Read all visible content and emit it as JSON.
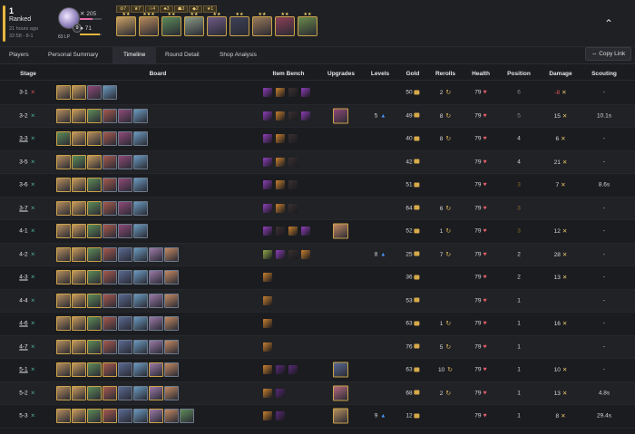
{
  "header": {
    "placement": "1",
    "mode": "Ranked",
    "time_ago": "21 hours ago",
    "duration_stage": "32:58 - 8-1",
    "level": "9",
    "lp": "83 LP",
    "stat_top": "205",
    "stat_bottom": "71",
    "stat_top_fill": 0.6,
    "stat_bottom_fill": 0.9,
    "traits": [
      "⚙7",
      "♛7",
      "☉4",
      "♣3",
      "☗3",
      "◆2",
      "★1"
    ],
    "champions": [
      {
        "color": "#c9a063",
        "stars": "★★"
      },
      {
        "color": "#b78a5a",
        "stars": "★★★"
      },
      {
        "color": "#5b8a5a",
        "stars": "★★"
      },
      {
        "color": "#8a9a86",
        "stars": "★★"
      },
      {
        "color": "#6f5a86",
        "stars": "★★"
      },
      {
        "color": "#3e4158",
        "stars": "★★"
      },
      {
        "color": "#9a7a58",
        "stars": "★★"
      },
      {
        "color": "#8c3f57",
        "stars": "★★"
      },
      {
        "color": "#6a8a4a",
        "stars": "★★"
      }
    ]
  },
  "tabs": [
    {
      "label": "Players",
      "active": false
    },
    {
      "label": "Personal Summary",
      "active": false
    },
    {
      "label": "Timeline",
      "active": true
    },
    {
      "label": "Round Detail",
      "active": false
    },
    {
      "label": "Shop Analysis",
      "active": false
    }
  ],
  "copy_link": "⇔ Copy Link",
  "columns": [
    "Stage",
    "Board",
    "Item Bench",
    "Upgrades",
    "Levels",
    "Gold",
    "Rerolls",
    "Health",
    "Position",
    "Damage",
    "Scouting"
  ],
  "unit_palette": [
    "#b58e5e",
    "#c79b5d",
    "#5f8c58",
    "#a65a4f",
    "#8f4a78",
    "#6a9abf",
    "#9c7aa8",
    "#c48a62",
    "#5a6a92",
    "#8a5a4a",
    "#b56a7e",
    "#7a8c5a"
  ],
  "item_palette": [
    "#8e3fb8",
    "#c9812f",
    "#3b3030",
    "#8fa84a",
    "#5a2a78",
    "#b0403a"
  ],
  "rows": [
    {
      "stage": "3-1",
      "result": "loss",
      "underline": false,
      "board": [
        0,
        1,
        4,
        5
      ],
      "stars": [
        2,
        2,
        1,
        1
      ],
      "items": [
        0,
        1,
        2,
        0
      ],
      "upgrades": [],
      "levels": "",
      "gold": "50",
      "rerolls": "2",
      "health": "79",
      "position": "6",
      "posc": "gray",
      "damage": "-8",
      "dmgc": "neg",
      "scouting": "-"
    },
    {
      "stage": "3-2",
      "result": "win",
      "underline": false,
      "board": [
        0,
        1,
        2,
        3,
        4,
        5
      ],
      "stars": [
        2,
        2,
        2,
        1,
        1,
        1
      ],
      "items": [
        0,
        1,
        2,
        0
      ],
      "upgrades": [
        4
      ],
      "levels": "5",
      "gold": "49",
      "rerolls": "8",
      "health": "79",
      "position": "5",
      "posc": "gray",
      "damage": "15",
      "dmgc": "pos",
      "scouting": "10.1s"
    },
    {
      "stage": "3-3",
      "result": "win",
      "underline": true,
      "board": [
        2,
        1,
        0,
        3,
        4,
        5
      ],
      "stars": [
        2,
        2,
        2,
        1,
        1,
        1
      ],
      "items": [
        0,
        1,
        2
      ],
      "upgrades": [],
      "levels": "",
      "gold": "40",
      "rerolls": "8",
      "health": "79",
      "position": "4",
      "posc": "norm",
      "damage": "6",
      "dmgc": "pos",
      "scouting": "-"
    },
    {
      "stage": "3-5",
      "result": "win",
      "underline": false,
      "board": [
        0,
        2,
        1,
        3,
        4,
        5
      ],
      "stars": [
        2,
        2,
        2,
        1,
        1,
        1
      ],
      "items": [
        0,
        1,
        2
      ],
      "upgrades": [],
      "levels": "",
      "gold": "42",
      "rerolls": "",
      "health": "79",
      "position": "4",
      "posc": "norm",
      "damage": "21",
      "dmgc": "pos",
      "scouting": "-"
    },
    {
      "stage": "3-6",
      "result": "win",
      "underline": false,
      "board": [
        0,
        1,
        2,
        3,
        4,
        5
      ],
      "stars": [
        2,
        2,
        2,
        1,
        1,
        1
      ],
      "items": [
        0,
        1,
        2
      ],
      "upgrades": [],
      "levels": "",
      "gold": "51",
      "rerolls": "",
      "health": "79",
      "position": "3",
      "posc": "muted",
      "damage": "7",
      "dmgc": "pos",
      "scouting": "8.6s"
    },
    {
      "stage": "3-7",
      "result": "win",
      "underline": true,
      "board": [
        0,
        1,
        2,
        3,
        4,
        5
      ],
      "stars": [
        2,
        2,
        2,
        1,
        1,
        1
      ],
      "items": [
        0,
        1,
        2
      ],
      "upgrades": [],
      "levels": "",
      "gold": "64",
      "rerolls": "6",
      "health": "79",
      "position": "3",
      "posc": "muted",
      "damage": "",
      "dmgc": "pos",
      "scouting": "-"
    },
    {
      "stage": "4-1",
      "result": "win",
      "underline": false,
      "board": [
        0,
        1,
        2,
        3,
        4,
        5
      ],
      "stars": [
        2,
        2,
        2,
        1,
        1,
        1
      ],
      "items": [
        0,
        2,
        1,
        0
      ],
      "upgrades": [
        7
      ],
      "levels": "",
      "gold": "52",
      "rerolls": "1",
      "health": "79",
      "position": "3",
      "posc": "muted",
      "damage": "12",
      "dmgc": "pos",
      "scouting": "-"
    },
    {
      "stage": "4-2",
      "result": "win",
      "underline": false,
      "board": [
        0,
        1,
        2,
        3,
        8,
        5,
        6,
        7
      ],
      "stars": [
        2,
        2,
        2,
        1,
        1,
        1,
        1,
        1
      ],
      "items": [
        3,
        0,
        2,
        1
      ],
      "upgrades": [],
      "levels": "8",
      "gold": "25",
      "rerolls": "7",
      "health": "79",
      "position": "2",
      "posc": "norm",
      "damage": "28",
      "dmgc": "pos",
      "scouting": "-"
    },
    {
      "stage": "4-3",
      "result": "win",
      "underline": true,
      "board": [
        0,
        1,
        2,
        3,
        8,
        5,
        6,
        7
      ],
      "stars": [
        2,
        2,
        2,
        1,
        1,
        1,
        1,
        1
      ],
      "items": [
        1
      ],
      "upgrades": [],
      "levels": "",
      "gold": "36",
      "rerolls": "",
      "health": "79",
      "position": "2",
      "posc": "norm",
      "damage": "13",
      "dmgc": "pos",
      "scouting": "-"
    },
    {
      "stage": "4-4",
      "result": "win",
      "underline": false,
      "board": [
        0,
        1,
        2,
        3,
        8,
        5,
        6,
        7
      ],
      "stars": [
        2,
        2,
        2,
        1,
        1,
        1,
        1,
        1
      ],
      "items": [
        1
      ],
      "upgrades": [],
      "levels": "",
      "gold": "53",
      "rerolls": "",
      "health": "79",
      "position": "1",
      "posc": "norm",
      "damage": "",
      "dmgc": "pos",
      "scouting": "-"
    },
    {
      "stage": "4-6",
      "result": "win",
      "underline": true,
      "board": [
        0,
        1,
        2,
        3,
        8,
        5,
        6,
        7
      ],
      "stars": [
        2,
        2,
        2,
        1,
        1,
        1,
        1,
        1
      ],
      "items": [
        1
      ],
      "upgrades": [],
      "levels": "",
      "gold": "63",
      "rerolls": "1",
      "health": "79",
      "position": "1",
      "posc": "norm",
      "damage": "16",
      "dmgc": "pos",
      "scouting": "-"
    },
    {
      "stage": "4-7",
      "result": "win",
      "underline": true,
      "board": [
        0,
        1,
        2,
        3,
        8,
        5,
        6,
        7
      ],
      "stars": [
        2,
        2,
        2,
        1,
        1,
        1,
        1,
        1
      ],
      "items": [
        1
      ],
      "upgrades": [],
      "levels": "",
      "gold": "76",
      "rerolls": "5",
      "health": "79",
      "position": "1",
      "posc": "norm",
      "damage": "",
      "dmgc": "pos",
      "scouting": "-"
    },
    {
      "stage": "5-1",
      "result": "win",
      "underline": true,
      "board": [
        0,
        1,
        2,
        3,
        8,
        5,
        6,
        7
      ],
      "stars": [
        2,
        2,
        2,
        2,
        1,
        1,
        2,
        1
      ],
      "items": [
        1,
        4,
        4
      ],
      "upgrades": [
        8
      ],
      "levels": "",
      "gold": "63",
      "rerolls": "10",
      "health": "79",
      "position": "1",
      "posc": "norm",
      "damage": "10",
      "dmgc": "pos",
      "scouting": "-"
    },
    {
      "stage": "5-2",
      "result": "win",
      "underline": false,
      "board": [
        0,
        1,
        2,
        3,
        8,
        5,
        6,
        7
      ],
      "stars": [
        2,
        2,
        2,
        2,
        1,
        1,
        2,
        1
      ],
      "items": [
        1,
        4
      ],
      "upgrades": [
        10
      ],
      "levels": "",
      "gold": "68",
      "rerolls": "2",
      "health": "79",
      "position": "1",
      "posc": "norm",
      "damage": "13",
      "dmgc": "pos",
      "scouting": "4.8s"
    },
    {
      "stage": "5-3",
      "result": "win",
      "underline": false,
      "board": [
        0,
        1,
        2,
        3,
        8,
        5,
        6,
        7,
        2
      ],
      "stars": [
        2,
        2,
        2,
        2,
        1,
        1,
        2,
        1,
        1
      ],
      "items": [
        1,
        4
      ],
      "upgrades": [
        0
      ],
      "levels": "9",
      "gold": "12",
      "rerolls": "",
      "health": "79",
      "position": "1",
      "posc": "norm",
      "damage": "8",
      "dmgc": "pos",
      "scouting": "29.4s"
    }
  ]
}
